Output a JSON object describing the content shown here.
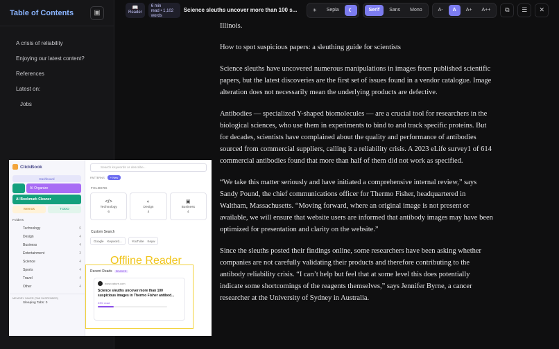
{
  "toc": {
    "title": "Table of Contents",
    "collapse_icon": "sidebar-collapse-icon",
    "items": [
      "A crisis of reliability",
      "Enjoying our latest content?",
      "References",
      "Latest on:"
    ],
    "subitems": [
      "Jobs"
    ]
  },
  "toolbar": {
    "reader_label": "Reader",
    "meta": [
      "6 min",
      "read • 1,102",
      "words"
    ],
    "article_title": "Science sleuths uncover more than 100 s...",
    "theme": {
      "sun_icon": "☀",
      "sepia": "Sepia",
      "moon_icon": "☾"
    },
    "fonts": [
      "Serif",
      "Sans",
      "Mono"
    ],
    "sizes": [
      "A-",
      "A",
      "A+",
      "A++"
    ],
    "tools": [
      "⧉",
      "☰",
      "✕"
    ]
  },
  "article": {
    "paragraphs": [
      "Illinois.",
      "How to spot suspicious papers: a sleuthing guide for scientists",
      "Science sleuths have uncovered numerous manipulations in images from published scientific papers, but the latest discoveries are the first set of issues found in a vendor catalogue. Image alteration does not necessarily mean the underlying products are defective.",
      "Antibodies — specialized Y-shaped biomolecules — are a crucial tool for researchers in the biological sciences, who use them in experiments to bind to and track specific proteins. But for decades, scientists have complained about the quality and performance of antibodies sourced from commercial suppliers, calling it a reliability crisis. A 2023 eLife survey1 of 614 commercial antibodies found that more than half of them did not work as specified.",
      "“We take this matter seriously and have initiated a comprehensive internal review,” says Sandy Pound, the chief communications officer for Thermo Fisher, headquartered in Waltham, Massachusetts. “Moving forward, where an original image is not present or available, we will ensure that website users are informed that antibody images may have been optimized for presentation and clarity on the website.”",
      "Since the sleuths posted their findings online, some researchers have been asking whether companies are not carefully validating their products and therefore contributing to the antibody reliability crisis. “I can’t help but feel that at some level this does potentially indicate some shortcomings of the reagents themselves,” says Jennifer Byrne, a cancer researcher at the University of Sydney in Australia."
    ]
  },
  "embed": {
    "app_name": "ClickBook",
    "dashboard": "Dashboard",
    "ai_organize": "AI Organize",
    "ai_cleaner": "AI Bookmark Cleaner",
    "memos": "Memos",
    "todo": "TODO",
    "folders_label": "Folders",
    "folders": [
      {
        "name": "Technology",
        "count": "6"
      },
      {
        "name": "Design",
        "count": "4"
      },
      {
        "name": "Business",
        "count": "4"
      },
      {
        "name": "Entertainment",
        "count": "3"
      },
      {
        "name": "Science",
        "count": "4"
      },
      {
        "name": "Sports",
        "count": "4"
      },
      {
        "name": "Travel",
        "count": "4"
      },
      {
        "name": "Other",
        "count": "4"
      }
    ],
    "memory_label": "MEMORY SAVER (TAB SUSPENDER)",
    "sleeping": "Sleeping Tabs: 0",
    "search_placeholder": "Search keywords or describe...",
    "patterns": "PATTERNS",
    "new": "+ New",
    "folders_heading": "FOLDERS",
    "cards": [
      {
        "icon": "</>",
        "name": "Technology",
        "count": "6"
      },
      {
        "icon": "◐",
        "name": "Design",
        "count": "4"
      },
      {
        "icon": "▣",
        "name": "Business",
        "count": "4"
      }
    ],
    "custom_search": "Custom Search",
    "engines": [
      "Google",
      "Keyword...",
      "YouTube",
      "Keyw"
    ],
    "recent_reads": "Recent Reads",
    "reader_tag": "READER",
    "item_url": "www.nature.com",
    "item_title": "Science sleuths uncover more than 100 suspicious images in Thermo Fisher antibod...",
    "item_read": "23% read",
    "item_progress": 0.23,
    "offline_label": "Offline Reader"
  }
}
